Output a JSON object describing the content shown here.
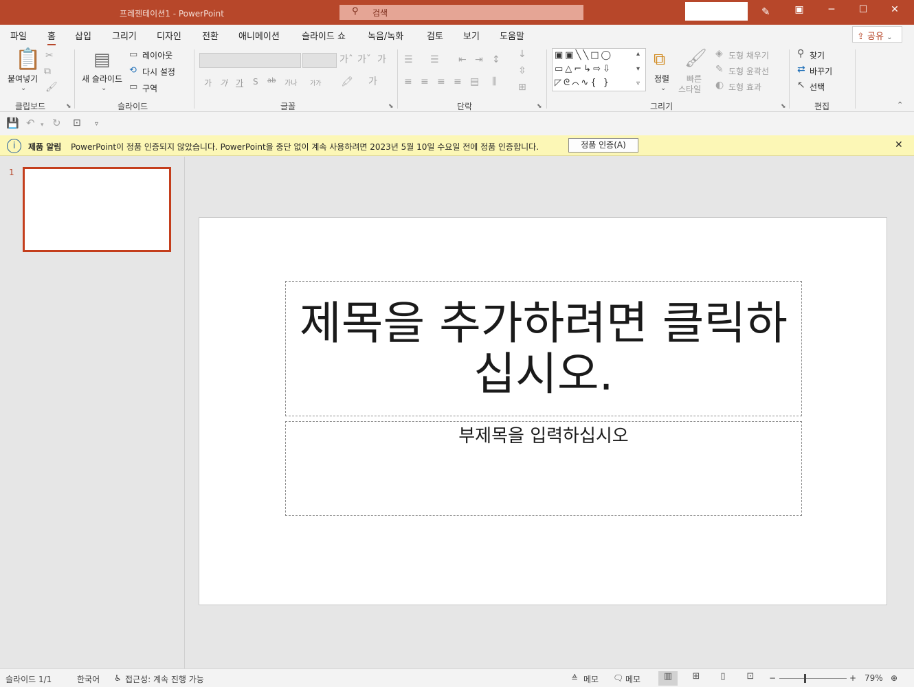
{
  "title_bar": {
    "title": "프레젠테이션1  -  PowerPoint",
    "search_placeholder": "검색",
    "minimize": "─",
    "restore": "☐",
    "close": "✕"
  },
  "tabs": [
    "파일",
    "홈",
    "삽입",
    "그리기",
    "디자인",
    "전환",
    "애니메이션",
    "슬라이드 쇼",
    "녹음/녹화",
    "검토",
    "보기",
    "도움말"
  ],
  "active_tab": "홈",
  "share_label": "공유",
  "ribbon": {
    "clipboard": {
      "paste_label": "붙여넣기",
      "group_label": "클립보드"
    },
    "slides": {
      "new_slide_label": "새 슬라이드",
      "layout_label": "레이아웃",
      "reset_label": "다시 설정",
      "section_label": "구역",
      "group_label": "슬라이드"
    },
    "font": {
      "group_label": "글꼴",
      "buttons": [
        "가",
        "가",
        "가",
        "S",
        "ab",
        "가나",
        "가가"
      ]
    },
    "paragraph": {
      "group_label": "단락"
    },
    "drawing": {
      "arrange_label": "정렬",
      "quick_styles_label_1": "빠른",
      "quick_styles_label_2": "스타일",
      "shape_fill_label": "도형 채우기",
      "shape_outline_label": "도형 윤곽선",
      "shape_effects_label": "도형 효과",
      "group_label": "그리기"
    },
    "editing": {
      "find_label": "찾기",
      "replace_label": "바꾸기",
      "select_label": "선택",
      "group_label": "편집"
    }
  },
  "notification": {
    "bold": "제품 알림",
    "message": "PowerPoint이 정품 인증되지 않았습니다. PowerPoint을 중단 없이 계속 사용하려면 2023년 5월 10일 수요일 전에 정품 인증합니다.",
    "button_label": "정품 인증(A)"
  },
  "thumbnail": {
    "number": "1"
  },
  "slide": {
    "title_placeholder": "제목을 추가하려면 클릭하십시오.",
    "subtitle_placeholder": "부제목을 입력하십시오"
  },
  "status_bar": {
    "slide_count": "슬라이드 1/1",
    "language": "한국어",
    "accessibility": "접근성: 계속 진행 가능",
    "notes_label": "메모",
    "comments_label": "메모",
    "zoom_minus": "−",
    "zoom_plus": "+",
    "zoom_level": "79%"
  }
}
